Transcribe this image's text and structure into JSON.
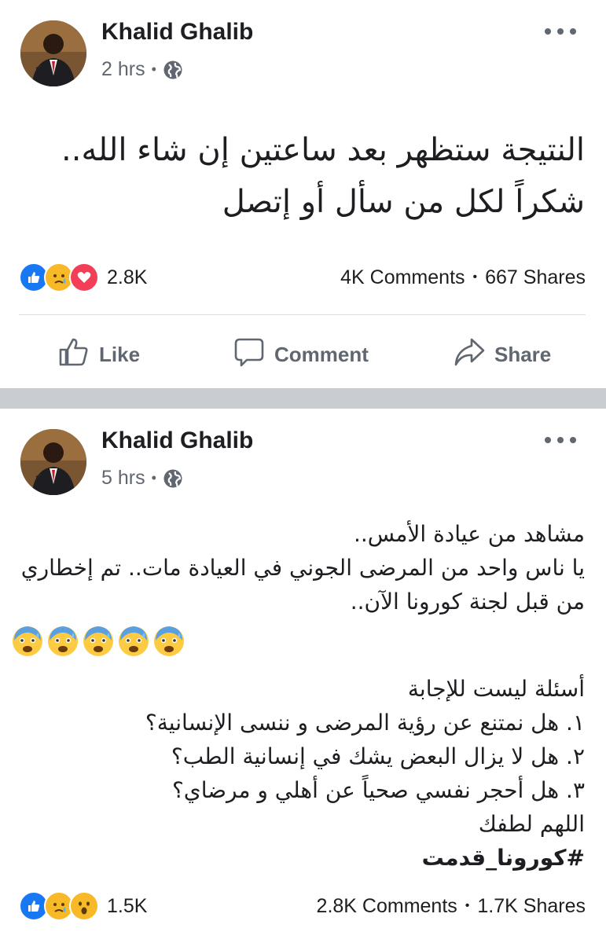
{
  "posts": [
    {
      "author": "Khalid Ghalib",
      "time": "2 hrs",
      "text": "النتيجة ستظهر بعد ساعتين إن شاء الله.. شكراً لكل من سأل أو إتصل",
      "reactions": {
        "icons": [
          "like",
          "sad",
          "love"
        ],
        "count": "2.8K"
      },
      "comments": "4K Comments",
      "shares": "667 Shares",
      "actions": {
        "like": "Like",
        "comment": "Comment",
        "share": "Share"
      }
    },
    {
      "author": "Khalid Ghalib",
      "time": "5 hrs",
      "lines": [
        "مشاهد من عيادة الأمس..",
        "يا ناس واحد من المرضى الجوني في العيادة مات.. تم إخطاري من قبل لجنة كورونا الآن..",
        "أسئلة ليست للإجابة",
        "١. هل نمتنع عن رؤية المرضى و ننسى الإنسانية؟",
        "٢. هل لا يزال البعض يشك في إنسانية الطب؟",
        "٣. هل أحجر نفسي صحياً عن أهلي و مرضاي؟",
        "اللهم لطفك",
        "#كورونا_قدمت"
      ],
      "emoji": [
        "anxious-face",
        "anxious-face",
        "anxious-face",
        "anxious-face",
        "anxious-face"
      ],
      "reactions": {
        "icons": [
          "like",
          "sad",
          "wow"
        ],
        "count": "1.5K"
      },
      "comments": "2.8K Comments",
      "shares": "1.7K Shares"
    }
  ],
  "colors": {
    "like_blue": "#1877f2",
    "love_red": "#f33e58",
    "emoji_yellow": "#f7b928",
    "secondary_text": "#606770",
    "separator": "#c9ccd1"
  }
}
